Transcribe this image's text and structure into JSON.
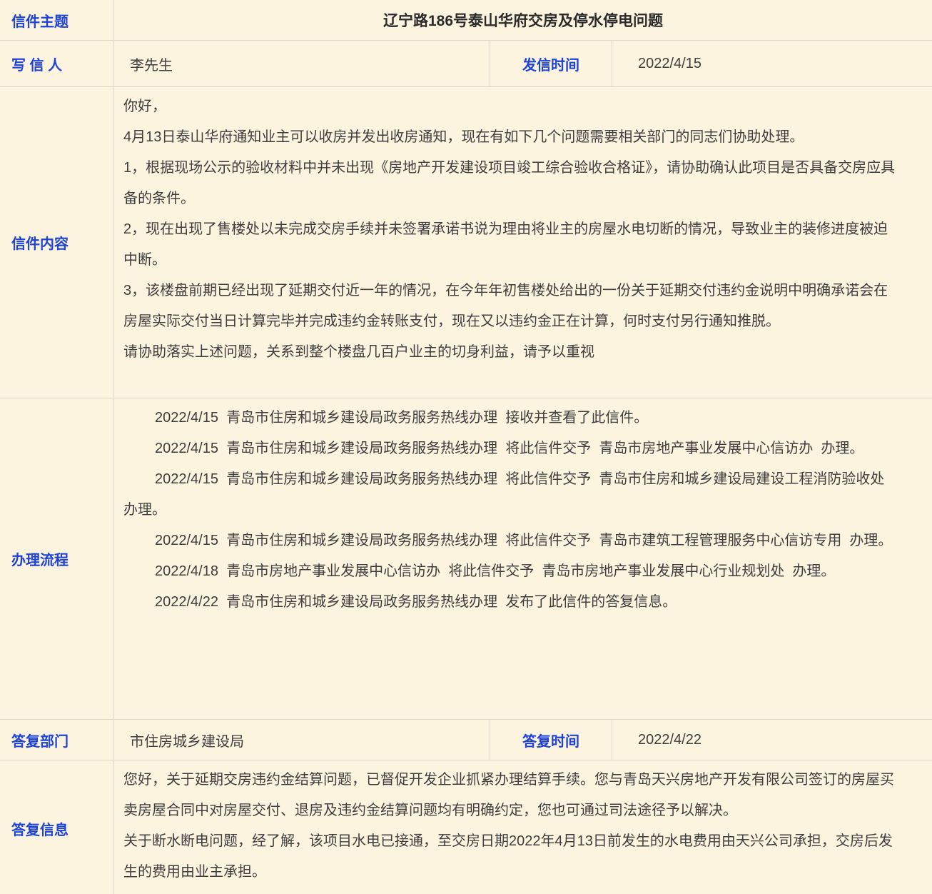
{
  "colors": {
    "background": "#fdf4e0",
    "label_blue": "#1d43d8",
    "body_text": "#3e3e3e",
    "title_text": "#2b2b2b",
    "border": "#dcd8cc"
  },
  "subject_row": {
    "label": "信件主题",
    "title": "辽宁路186号泰山华府交房及停水停电问题"
  },
  "sender_row": {
    "label": "写 信 人",
    "value": "李先生",
    "time_label": "发信时间",
    "time_value": "2022/4/15"
  },
  "content_row": {
    "label": "信件内容",
    "paragraphs": [
      "你好，",
      "4月13日泰山华府通知业主可以收房并发出收房通知，现在有如下几个问题需要相关部门的同志们协助处理。",
      "1，根据现场公示的验收材料中并未出现《房地产开发建设项目竣工综合验收合格证》，请协助确认此项目是否具备交房应具备的条件。",
      "2，现在出现了售楼处以未完成交房手续并未签署承诺书说为理由将业主的房屋水电切断的情况，导致业主的装修进度被迫中断。",
      "3，该楼盘前期已经出现了延期交付近一年的情况，在今年年初售楼处给出的一份关于延期交付违约金说明中明确承诺会在房屋实际交付当日计算完毕并完成违约金转账支付，现在又以违约金正在计算，何时支付另行通知推脱。",
      "请协助落实上述问题，关系到整个楼盘几百户业主的切身利益，请予以重视"
    ]
  },
  "process_row": {
    "label": "办理流程",
    "entries": [
      "2022/4/15  青岛市住房和城乡建设局政务服务热线办理  接收并查看了此信件。",
      "2022/4/15  青岛市住房和城乡建设局政务服务热线办理  将此信件交予  青岛市房地产事业发展中心信访办  办理。",
      "2022/4/15  青岛市住房和城乡建设局政务服务热线办理  将此信件交予  青岛市住房和城乡建设局建设工程消防验收处  办理。",
      "2022/4/15  青岛市住房和城乡建设局政务服务热线办理  将此信件交予  青岛市建筑工程管理服务中心信访专用  办理。",
      "2022/4/18  青岛市房地产事业发展中心信访办  将此信件交予  青岛市房地产事业发展中心行业规划处  办理。",
      "2022/4/22  青岛市住房和城乡建设局政务服务热线办理  发布了此信件的答复信息。"
    ]
  },
  "reply_dept_row": {
    "label": "答复部门",
    "value": "市住房城乡建设局",
    "time_label": "答复时间",
    "time_value": "2022/4/22"
  },
  "reply_row": {
    "label": "答复信息",
    "paragraphs": [
      "您好，关于延期交房违约金结算问题，已督促开发企业抓紧办理结算手续。您与青岛天兴房地产开发有限公司签订的房屋买卖房屋合同中对房屋交付、退房及违约金结算问题均有明确约定，您也可通过司法途径予以解决。",
      "关于断水断电问题，经了解，该项目水电已接通，至交房日期2022年4月13日前发生的水电费用由天兴公司承担，交房后发生的费用由业主承担。"
    ]
  }
}
